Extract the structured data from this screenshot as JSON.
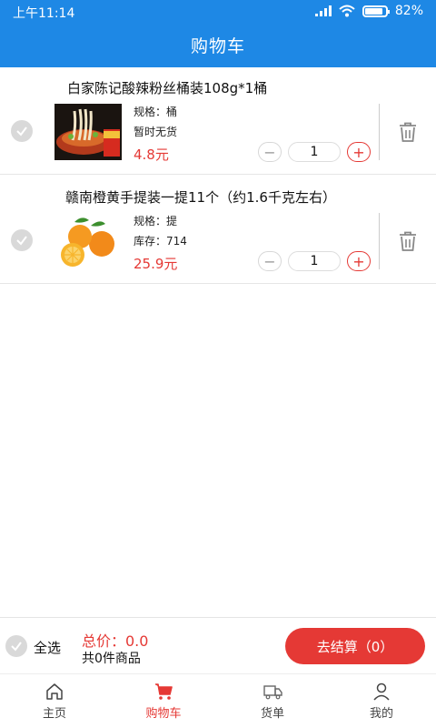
{
  "status": {
    "time": "上午11:14",
    "battery": "82%"
  },
  "header": {
    "title": "购物车"
  },
  "items": [
    {
      "name": "白家陈记酸辣粉丝桶装108g*1桶",
      "spec": "规格：桶",
      "stock": "暂时无货",
      "price": "4.8元",
      "qty": "1",
      "image_icon": "noodle-bucket-image"
    },
    {
      "name": "赣南橙黄手提装一提11个（约1.6千克左右）",
      "spec": "规格：提",
      "stock": "库存：714",
      "price": "25.9元",
      "qty": "1",
      "image_icon": "orange-fruit-image"
    }
  ],
  "stepper": {
    "minus": "−",
    "plus": "+"
  },
  "checkout": {
    "select_all": "全选",
    "total": "总价：0.0",
    "count": "共0件商品",
    "pay_button": "去结算（0）"
  },
  "nav": [
    {
      "label": "主页",
      "icon": "home-icon"
    },
    {
      "label": "购物车",
      "icon": "cart-icon",
      "active": true
    },
    {
      "label": "货单",
      "icon": "delivery-truck-icon"
    },
    {
      "label": "我的",
      "icon": "user-icon"
    }
  ],
  "colors": {
    "primary": "#1E88E5",
    "accent": "#E53935"
  }
}
